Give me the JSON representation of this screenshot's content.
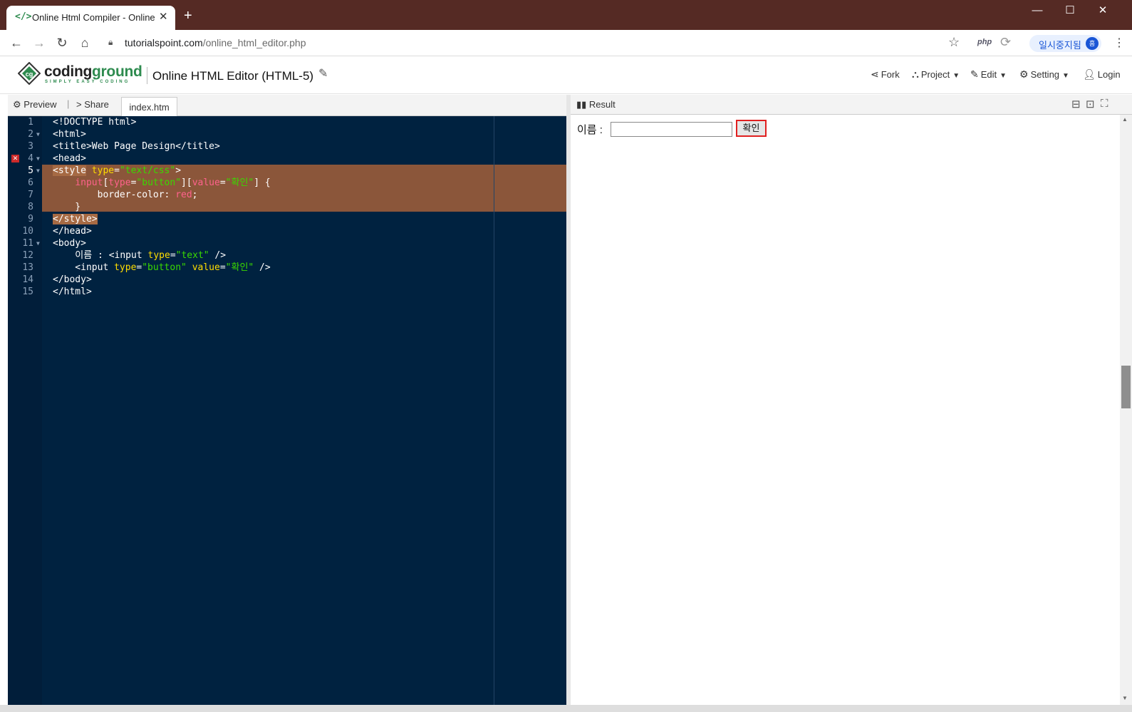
{
  "browser": {
    "tab_title": "Online Html Compiler - Online H",
    "tab_favicon": "</>",
    "url_host": "tutorialspoint.com",
    "url_path": "/online_html_editor.php",
    "profile_label": "일시중지됨",
    "profile_initial": "흠",
    "extension_php": "php"
  },
  "site": {
    "logo_word_a": "coding",
    "logo_word_b": "ground",
    "logo_tagline": "SIMPLY EASY CODING",
    "editor_title": "Online HTML Editor (HTML-5)",
    "menu": {
      "fork": "Fork",
      "project": "Project",
      "edit": "Edit",
      "setting": "Setting",
      "login": "Login"
    }
  },
  "editor": {
    "preview_label": "Preview",
    "share_label": "Share",
    "file_tab": "index.htm",
    "line_numbers": [
      "1",
      "2",
      "3",
      "4",
      "5",
      "6",
      "7",
      "8",
      "9",
      "10",
      "11",
      "12",
      "13",
      "14",
      "15"
    ]
  },
  "result": {
    "title": "Result",
    "name_label": "이름 :",
    "confirm_label": "확인"
  },
  "colors": {
    "titlebar": "#552a24",
    "editor_bg": "#002240",
    "selection": "#8b563a",
    "accent_green": "#2e8b4f",
    "button_border": "#e02020"
  }
}
